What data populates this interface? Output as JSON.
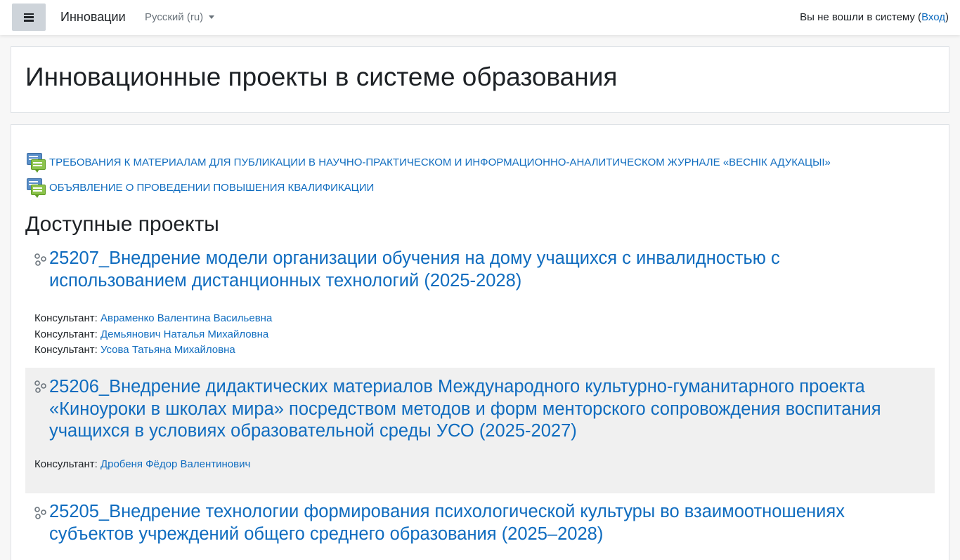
{
  "navbar": {
    "brand": "Инновации",
    "language": "Русский (ru)",
    "login_text": "Вы не вошли в систему (",
    "login_link": "Вход",
    "login_close": ")"
  },
  "page": {
    "title": "Инновационные проекты в системе образования"
  },
  "news": [
    {
      "label": "ТРЕБОВАНИЯ К МАТЕРИАЛАМ ДЛЯ ПУБЛИКАЦИИ В НАУЧНО-ПРАКТИЧЕСКОМ И ИНФОРМАЦИОННО-АНАЛИТИЧЕСКОМ ЖУРНАЛЕ «ВЕСНІК АДУКАЦЫІ»"
    },
    {
      "label": "ОБЪЯВЛЕНИЕ О ПРОВЕДЕНИИ ПОВЫШЕНИЯ КВАЛИФИКАЦИИ"
    }
  ],
  "section": {
    "title": "Доступные проекты"
  },
  "courses": [
    {
      "title": "25207_Внедрение модели организации обучения на дому учащихся с инвалидностью с использованием дистанционных технологий (2025-2028)",
      "teachers": [
        {
          "role": "Консультант: ",
          "name": "Авраменко Валентина Васильевна"
        },
        {
          "role": "Консультант: ",
          "name": "Демьянович Наталья Михайловна"
        },
        {
          "role": "Консультант: ",
          "name": "Усова Татьяна Михайловна"
        }
      ]
    },
    {
      "title": "25206_Внедрение дидактических материалов Международного культурно-гуманитарного проекта «Киноуроки в школах мира» посредством методов и форм менторского сопровождения воспитания учащихся в условиях образовательной среды УСО (2025-2027)",
      "teachers": [
        {
          "role": "Консультант: ",
          "name": "Дробеня Фёдор Валентинович"
        }
      ]
    },
    {
      "title": "25205_Внедрение технологии формирования психологической культуры во взаимоотношениях субъектов учреждений общего среднего образования (2025–2028)",
      "teachers": []
    }
  ]
}
